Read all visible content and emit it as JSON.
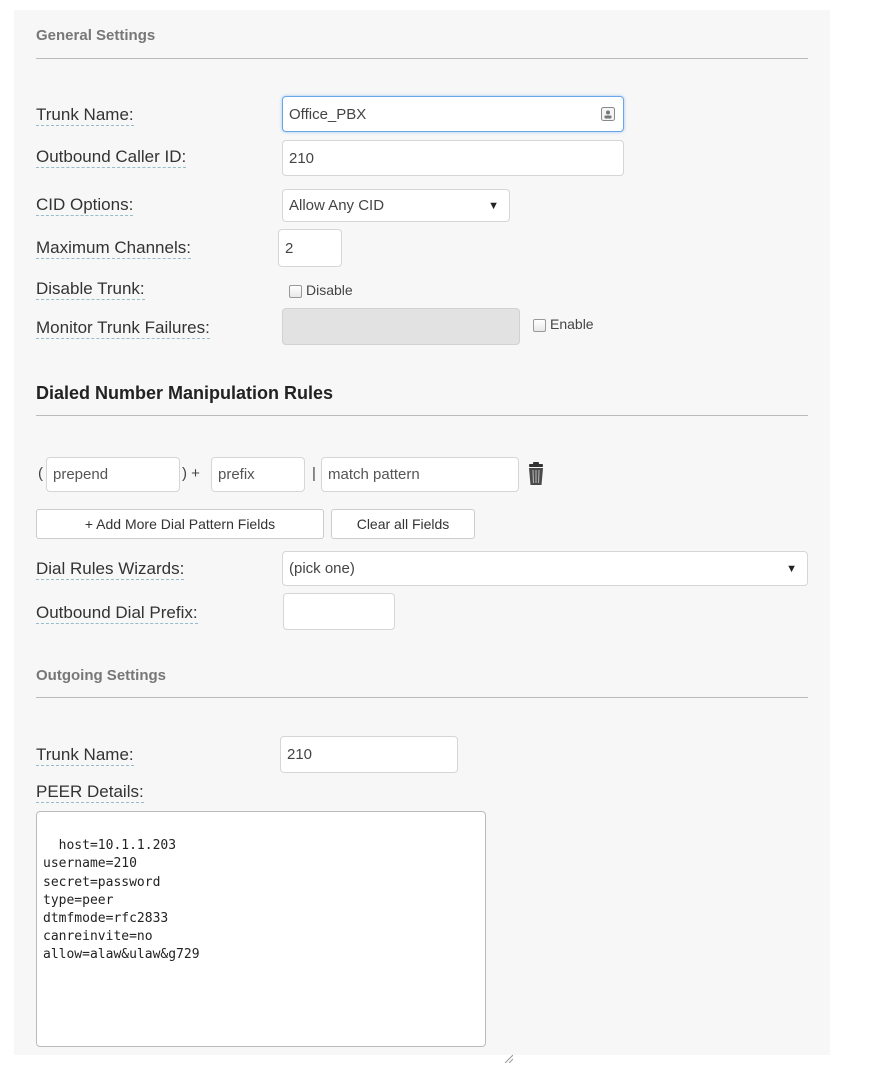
{
  "general": {
    "heading": "General Settings",
    "trunk_name_label": "Trunk Name:",
    "trunk_name_value": "Office_PBX",
    "outbound_cid_label": "Outbound Caller ID:",
    "outbound_cid_value": "210",
    "cid_options_label": "CID Options:",
    "cid_options_value": "Allow Any CID",
    "max_channels_label": "Maximum Channels:",
    "max_channels_value": "2",
    "disable_trunk_label": "Disable Trunk:",
    "disable_checkbox_label": "Disable",
    "monitor_label": "Monitor Trunk Failures:",
    "monitor_checkbox_label": "Enable"
  },
  "dial_rules": {
    "heading": "Dialed Number Manipulation Rules",
    "open_paren": "(",
    "prepend_placeholder": "prepend",
    "close_plus": ") +",
    "prefix_placeholder": "prefix",
    "pipe": "|",
    "match_placeholder": "match pattern",
    "add_more_label": "+ Add More Dial Pattern Fields",
    "clear_label": "Clear all Fields",
    "wizards_label": "Dial Rules Wizards:",
    "wizards_value": "(pick one)",
    "outbound_prefix_label": "Outbound Dial Prefix:",
    "outbound_prefix_value": ""
  },
  "outgoing": {
    "heading": "Outgoing Settings",
    "trunk_name_label": "Trunk Name:",
    "trunk_name_value": "210",
    "peer_label": "PEER Details:",
    "peer_details": "host=10.1.1.203\nusername=210\nsecret=password\ntype=peer\ndtmfmode=rfc2833\ncanreinvite=no\nallow=alaw&ulaw&g729"
  },
  "icons": {
    "contact_card": "contact-card-icon",
    "trash": "trash-icon",
    "dropdown": "dropdown-arrow-icon"
  }
}
